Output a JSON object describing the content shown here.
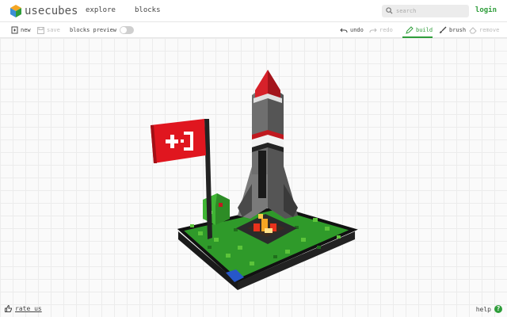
{
  "app": {
    "brand": "usecubes",
    "brand_color": "#2e9d3a"
  },
  "nav": {
    "explore": "explore",
    "blocks": "blocks"
  },
  "search": {
    "placeholder": "search"
  },
  "account": {
    "login": "login"
  },
  "toolbar": {
    "new": "new",
    "save": "save",
    "blocks_preview": "blocks preview",
    "blocks_preview_on": false,
    "undo": "undo",
    "redo": "redo",
    "build": "build",
    "brush": "brush",
    "remove": "remove",
    "active_tool": "build"
  },
  "footer": {
    "rate": "rate us",
    "help": "help"
  }
}
